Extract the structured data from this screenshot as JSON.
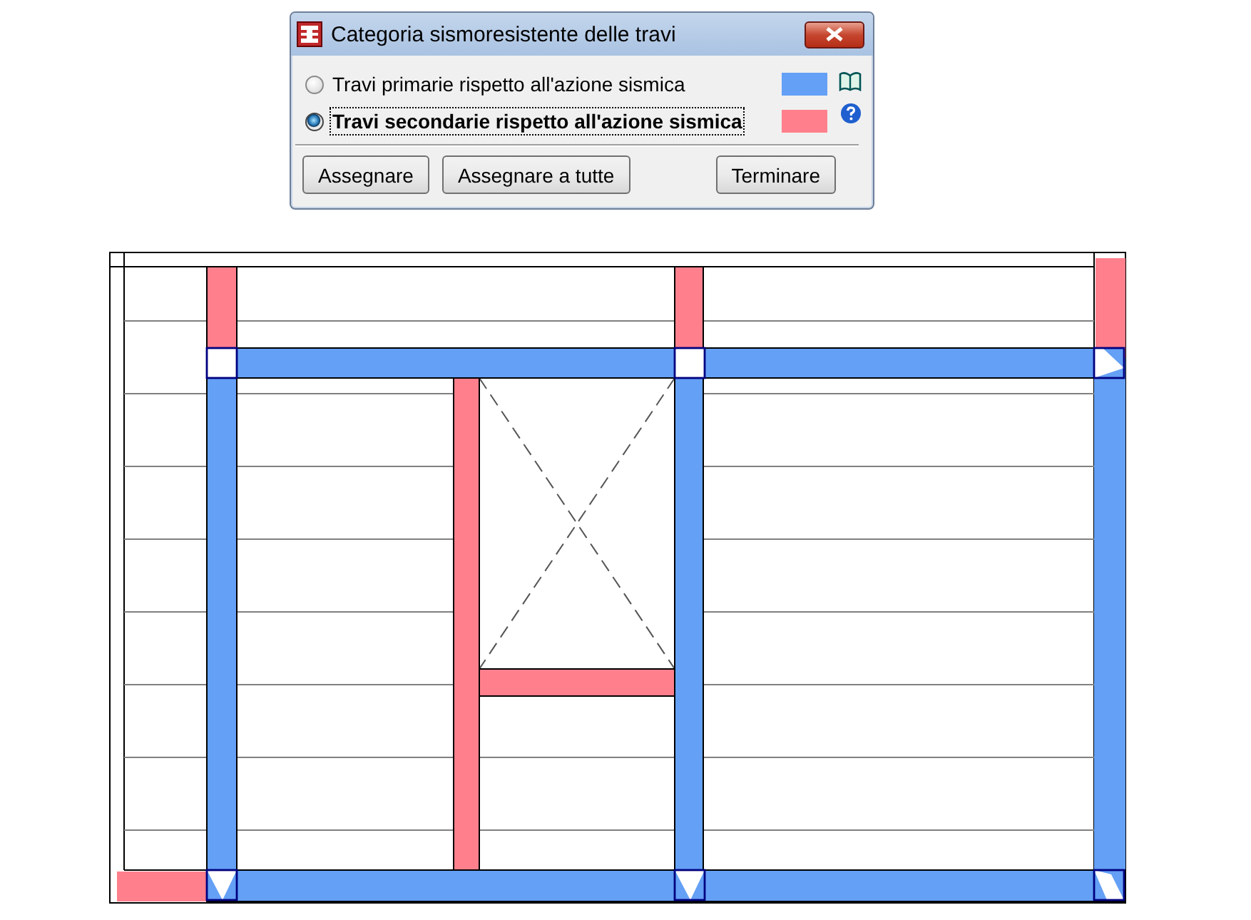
{
  "window": {
    "title": "Categoria sismoresistente delle travi"
  },
  "options": [
    {
      "label": "Travi primarie rispetto all'azione sismica",
      "selected": false,
      "color": "#64a0f5"
    },
    {
      "label": "Travi secondarie rispetto all'azione sismica",
      "selected": true,
      "color": "#ff808c"
    }
  ],
  "buttons": [
    "Assegnare",
    "Assegnare a tutte",
    "Terminare"
  ]
}
